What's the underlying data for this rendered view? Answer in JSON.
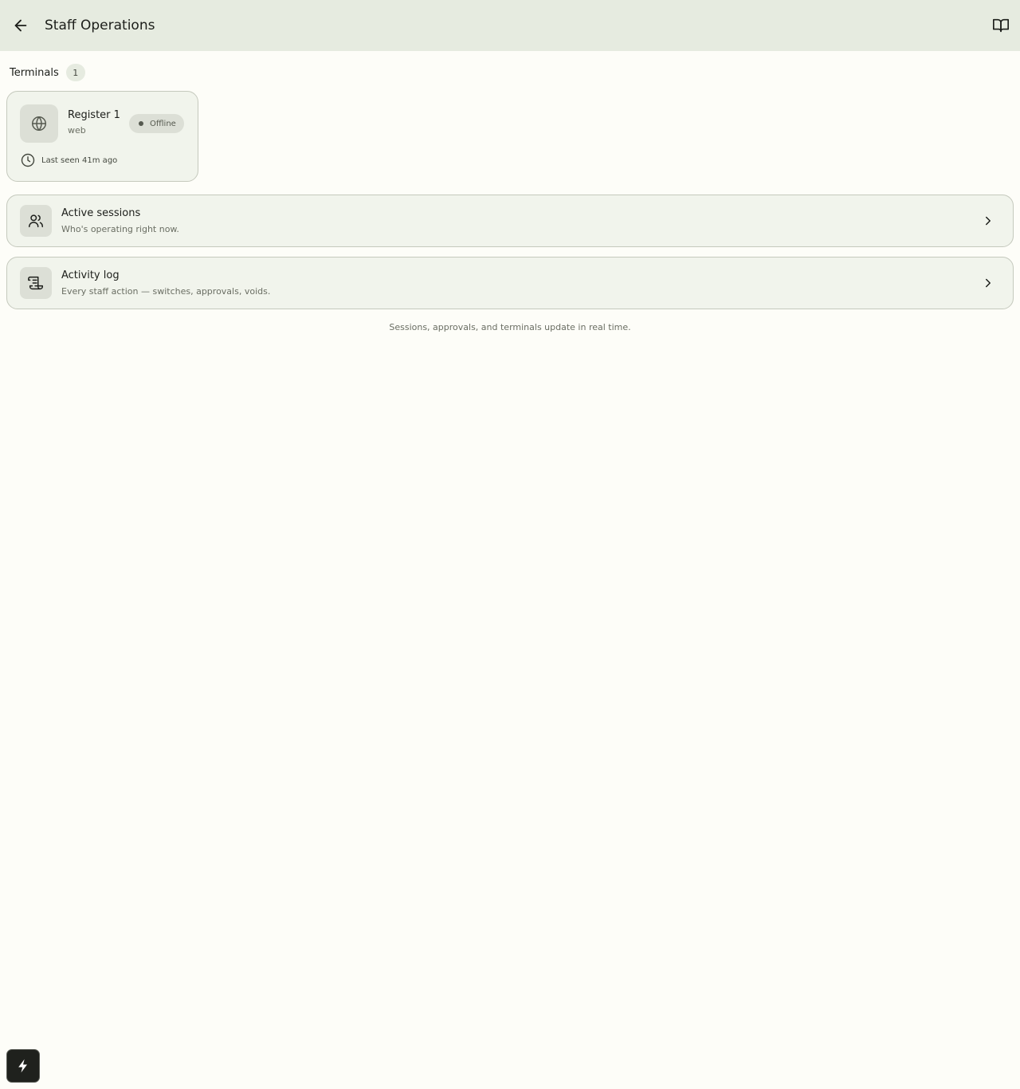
{
  "header": {
    "title": "Staff Operations",
    "back_icon": "arrow-left-icon",
    "guide_icon": "book-open-icon"
  },
  "terminals": {
    "label": "Terminals",
    "count": "1",
    "items": [
      {
        "name": "Register 1",
        "platform": "web",
        "status": "Offline",
        "last_seen": "Last seen 41m ago",
        "icon": "globe-icon"
      }
    ]
  },
  "nav": {
    "active_sessions": {
      "title": "Active sessions",
      "subtitle": "Who's operating right now.",
      "icon": "users-icon"
    },
    "activity_log": {
      "title": "Activity log",
      "subtitle": "Every staff action — switches, approvals, voids.",
      "icon": "scroll-text-icon"
    }
  },
  "footer": {
    "note": "Sessions, approvals, and terminals update in real time."
  },
  "quick_action_icon": "lightning-icon",
  "colors": {
    "background": "#fdfdf8",
    "header_bg": "#e6ebe0",
    "card_bg": "#f1f4ec",
    "border": "#c5c9bd",
    "text": "#1c1e1a",
    "muted_text": "#6a6e63"
  }
}
